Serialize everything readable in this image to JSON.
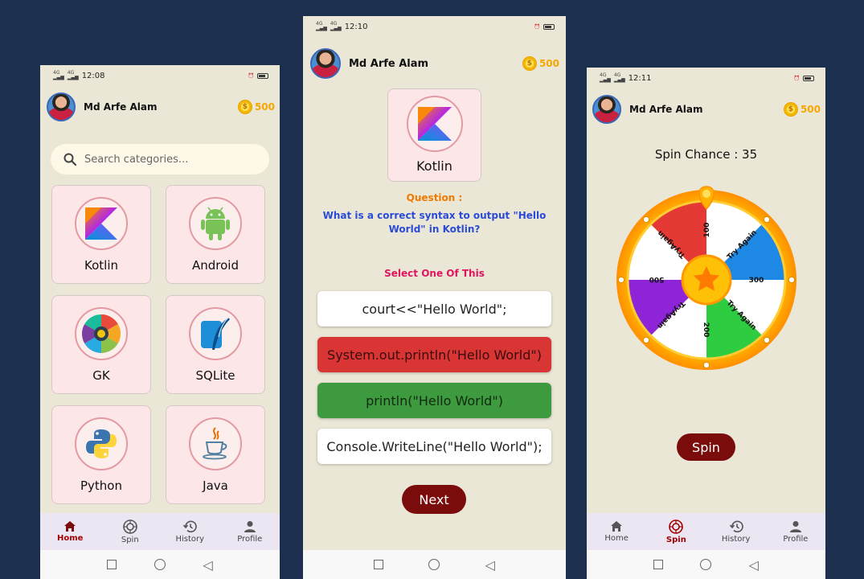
{
  "user": {
    "name": "Md Arfe Alam",
    "coins": "500"
  },
  "phone1": {
    "status": {
      "time": "12:08",
      "network": "4G"
    },
    "search": {
      "placeholder": "Search categories..."
    },
    "categories": [
      {
        "label": "Kotlin",
        "icon": "kotlin-logo-icon"
      },
      {
        "label": "Android",
        "icon": "android-robot-icon"
      },
      {
        "label": "GK",
        "icon": "gk-wheel-icon"
      },
      {
        "label": "SQLite",
        "icon": "sqlite-feather-icon"
      },
      {
        "label": "Python",
        "icon": "python-logo-icon"
      },
      {
        "label": "Java",
        "icon": "java-cup-icon"
      }
    ]
  },
  "phone2": {
    "status": {
      "time": "12:10",
      "network": "4G"
    },
    "category": "Kotlin",
    "question_label": "Question :",
    "question_text": "What is a correct syntax to output \"Hello World\" in Kotlin?",
    "select_label": "Select One Of This",
    "options": [
      {
        "text": "court<<\"Hello World\";",
        "state": "default"
      },
      {
        "text": "System.out.println(\"Hello World\")",
        "state": "wrong"
      },
      {
        "text": "println(\"Hello World\")",
        "state": "correct"
      },
      {
        "text": "Console.WriteLine(\"Hello World\");",
        "state": "default"
      }
    ],
    "next_label": "Next"
  },
  "phone3": {
    "status": {
      "time": "12:11",
      "network": "4G"
    },
    "spin_chance": "Spin Chance : 35",
    "wheel_segments": [
      "100",
      "Try Again",
      "300",
      "Try Again",
      "200",
      "TryAgain",
      "500",
      "TryAgain"
    ],
    "spin_label": "Spin"
  },
  "bottom_nav": {
    "home": "Home",
    "spin": "Spin",
    "history": "History",
    "profile": "Profile"
  },
  "colors": {
    "background": "#1c2f4e",
    "accent_dark_red": "#7a0c0c",
    "coin_gold": "#f5a700",
    "question_blue": "#2a4bd7",
    "question_orange": "#f07a00",
    "select_pink": "#e0135f"
  }
}
